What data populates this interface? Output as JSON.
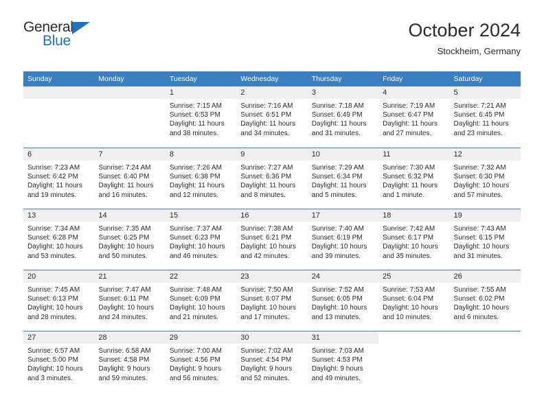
{
  "brand": {
    "name_part1": "General",
    "name_part2": "Blue",
    "accent_color": "#1e72bd"
  },
  "header": {
    "title": "October 2024",
    "subtitle": "Stockheim, Germany"
  },
  "calendar": {
    "header_bg": "#3a7fc2",
    "date_bg": "#efefef",
    "day_names": [
      "Sunday",
      "Monday",
      "Tuesday",
      "Wednesday",
      "Thursday",
      "Friday",
      "Saturday"
    ],
    "weeks": [
      [
        {
          "date": "",
          "empty": true
        },
        {
          "date": "",
          "empty": true
        },
        {
          "date": "1",
          "sunrise": "Sunrise: 7:15 AM",
          "sunset": "Sunset: 6:53 PM",
          "daylight1": "Daylight: 11 hours",
          "daylight2": "and 38 minutes."
        },
        {
          "date": "2",
          "sunrise": "Sunrise: 7:16 AM",
          "sunset": "Sunset: 6:51 PM",
          "daylight1": "Daylight: 11 hours",
          "daylight2": "and 34 minutes."
        },
        {
          "date": "3",
          "sunrise": "Sunrise: 7:18 AM",
          "sunset": "Sunset: 6:49 PM",
          "daylight1": "Daylight: 11 hours",
          "daylight2": "and 31 minutes."
        },
        {
          "date": "4",
          "sunrise": "Sunrise: 7:19 AM",
          "sunset": "Sunset: 6:47 PM",
          "daylight1": "Daylight: 11 hours",
          "daylight2": "and 27 minutes."
        },
        {
          "date": "5",
          "sunrise": "Sunrise: 7:21 AM",
          "sunset": "Sunset: 6:45 PM",
          "daylight1": "Daylight: 11 hours",
          "daylight2": "and 23 minutes."
        }
      ],
      [
        {
          "date": "6",
          "sunrise": "Sunrise: 7:23 AM",
          "sunset": "Sunset: 6:42 PM",
          "daylight1": "Daylight: 11 hours",
          "daylight2": "and 19 minutes."
        },
        {
          "date": "7",
          "sunrise": "Sunrise: 7:24 AM",
          "sunset": "Sunset: 6:40 PM",
          "daylight1": "Daylight: 11 hours",
          "daylight2": "and 16 minutes."
        },
        {
          "date": "8",
          "sunrise": "Sunrise: 7:26 AM",
          "sunset": "Sunset: 6:38 PM",
          "daylight1": "Daylight: 11 hours",
          "daylight2": "and 12 minutes."
        },
        {
          "date": "9",
          "sunrise": "Sunrise: 7:27 AM",
          "sunset": "Sunset: 6:36 PM",
          "daylight1": "Daylight: 11 hours",
          "daylight2": "and 8 minutes."
        },
        {
          "date": "10",
          "sunrise": "Sunrise: 7:29 AM",
          "sunset": "Sunset: 6:34 PM",
          "daylight1": "Daylight: 11 hours",
          "daylight2": "and 5 minutes."
        },
        {
          "date": "11",
          "sunrise": "Sunrise: 7:30 AM",
          "sunset": "Sunset: 6:32 PM",
          "daylight1": "Daylight: 11 hours",
          "daylight2": "and 1 minute."
        },
        {
          "date": "12",
          "sunrise": "Sunrise: 7:32 AM",
          "sunset": "Sunset: 6:30 PM",
          "daylight1": "Daylight: 10 hours",
          "daylight2": "and 57 minutes."
        }
      ],
      [
        {
          "date": "13",
          "sunrise": "Sunrise: 7:34 AM",
          "sunset": "Sunset: 6:28 PM",
          "daylight1": "Daylight: 10 hours",
          "daylight2": "and 53 minutes."
        },
        {
          "date": "14",
          "sunrise": "Sunrise: 7:35 AM",
          "sunset": "Sunset: 6:25 PM",
          "daylight1": "Daylight: 10 hours",
          "daylight2": "and 50 minutes."
        },
        {
          "date": "15",
          "sunrise": "Sunrise: 7:37 AM",
          "sunset": "Sunset: 6:23 PM",
          "daylight1": "Daylight: 10 hours",
          "daylight2": "and 46 minutes."
        },
        {
          "date": "16",
          "sunrise": "Sunrise: 7:38 AM",
          "sunset": "Sunset: 6:21 PM",
          "daylight1": "Daylight: 10 hours",
          "daylight2": "and 42 minutes."
        },
        {
          "date": "17",
          "sunrise": "Sunrise: 7:40 AM",
          "sunset": "Sunset: 6:19 PM",
          "daylight1": "Daylight: 10 hours",
          "daylight2": "and 39 minutes."
        },
        {
          "date": "18",
          "sunrise": "Sunrise: 7:42 AM",
          "sunset": "Sunset: 6:17 PM",
          "daylight1": "Daylight: 10 hours",
          "daylight2": "and 35 minutes."
        },
        {
          "date": "19",
          "sunrise": "Sunrise: 7:43 AM",
          "sunset": "Sunset: 6:15 PM",
          "daylight1": "Daylight: 10 hours",
          "daylight2": "and 31 minutes."
        }
      ],
      [
        {
          "date": "20",
          "sunrise": "Sunrise: 7:45 AM",
          "sunset": "Sunset: 6:13 PM",
          "daylight1": "Daylight: 10 hours",
          "daylight2": "and 28 minutes."
        },
        {
          "date": "21",
          "sunrise": "Sunrise: 7:47 AM",
          "sunset": "Sunset: 6:11 PM",
          "daylight1": "Daylight: 10 hours",
          "daylight2": "and 24 minutes."
        },
        {
          "date": "22",
          "sunrise": "Sunrise: 7:48 AM",
          "sunset": "Sunset: 6:09 PM",
          "daylight1": "Daylight: 10 hours",
          "daylight2": "and 21 minutes."
        },
        {
          "date": "23",
          "sunrise": "Sunrise: 7:50 AM",
          "sunset": "Sunset: 6:07 PM",
          "daylight1": "Daylight: 10 hours",
          "daylight2": "and 17 minutes."
        },
        {
          "date": "24",
          "sunrise": "Sunrise: 7:52 AM",
          "sunset": "Sunset: 6:05 PM",
          "daylight1": "Daylight: 10 hours",
          "daylight2": "and 13 minutes."
        },
        {
          "date": "25",
          "sunrise": "Sunrise: 7:53 AM",
          "sunset": "Sunset: 6:04 PM",
          "daylight1": "Daylight: 10 hours",
          "daylight2": "and 10 minutes."
        },
        {
          "date": "26",
          "sunrise": "Sunrise: 7:55 AM",
          "sunset": "Sunset: 6:02 PM",
          "daylight1": "Daylight: 10 hours",
          "daylight2": "and 6 minutes."
        }
      ],
      [
        {
          "date": "27",
          "sunrise": "Sunrise: 6:57 AM",
          "sunset": "Sunset: 5:00 PM",
          "daylight1": "Daylight: 10 hours",
          "daylight2": "and 3 minutes."
        },
        {
          "date": "28",
          "sunrise": "Sunrise: 6:58 AM",
          "sunset": "Sunset: 4:58 PM",
          "daylight1": "Daylight: 9 hours",
          "daylight2": "and 59 minutes."
        },
        {
          "date": "29",
          "sunrise": "Sunrise: 7:00 AM",
          "sunset": "Sunset: 4:56 PM",
          "daylight1": "Daylight: 9 hours",
          "daylight2": "and 56 minutes."
        },
        {
          "date": "30",
          "sunrise": "Sunrise: 7:02 AM",
          "sunset": "Sunset: 4:54 PM",
          "daylight1": "Daylight: 9 hours",
          "daylight2": "and 52 minutes."
        },
        {
          "date": "31",
          "sunrise": "Sunrise: 7:03 AM",
          "sunset": "Sunset: 4:53 PM",
          "daylight1": "Daylight: 9 hours",
          "daylight2": "and 49 minutes."
        },
        {
          "date": "",
          "empty": true,
          "blank": true
        },
        {
          "date": "",
          "empty": true,
          "blank": true
        }
      ]
    ]
  }
}
